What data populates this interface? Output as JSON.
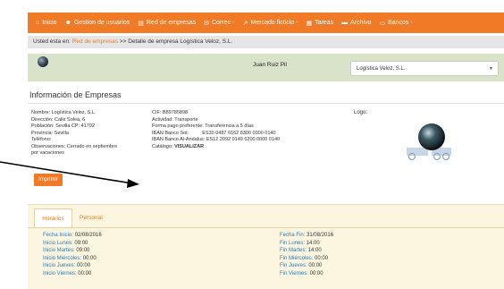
{
  "nav": {
    "items": [
      {
        "icon": "home-icon",
        "glyph": "⌂",
        "label": "Inicio"
      },
      {
        "icon": "users-icon",
        "glyph": "☻",
        "label": "Gestion de usuarios"
      },
      {
        "icon": "document-icon",
        "glyph": "▤",
        "label": "Red de empresas"
      },
      {
        "icon": "mail-icon",
        "glyph": "✉",
        "label": "Correo -"
      },
      {
        "icon": "chart-icon",
        "glyph": "↗",
        "label": "Mercado ficticio -"
      },
      {
        "icon": "calendar-icon",
        "glyph": "▦",
        "label": "Tareas"
      },
      {
        "icon": "folder-icon",
        "glyph": "▬",
        "label": "Archivo"
      },
      {
        "icon": "bank-icon",
        "glyph": "▭",
        "label": "Bancos -"
      }
    ],
    "color": "#f07a25"
  },
  "breadcrumb": {
    "prefix": "Usted esta en:",
    "link": "Red de empresas",
    "rest": ">> Detalle de empresa Logística Veloz, S.L."
  },
  "user": {
    "name": "Juan Ruiz Pil",
    "company_select": "Logística Veloz, S.L."
  },
  "company": {
    "title": "Información de Empresas",
    "left": [
      {
        "label": "Nombre:",
        "value": "Logística Veloz, S.L."
      },
      {
        "label": "Dirección:",
        "value": "Calle Soleá, 6"
      },
      {
        "label": "Población:",
        "value": "Sevilla CP: 41702"
      },
      {
        "label": "Provincia:",
        "value": "Sevilla"
      },
      {
        "label": "Teléfono:",
        "value": ""
      },
      {
        "label": "Observaciones:",
        "value": "Cerrado en septiembre"
      },
      {
        "label": "",
        "value": "por vacaciones"
      }
    ],
    "right": [
      {
        "label": "CIF:",
        "value": "B89785898"
      },
      {
        "label": "Actividad:",
        "value": "Transporte"
      },
      {
        "label": "Forma pago preferente:",
        "value": "Transferencia a 5 días"
      },
      {
        "label": "IBAN Banco Sol:",
        "value": "ES30 0487 0162 8300 0000 0140"
      },
      {
        "label": "IBAN Banco Al-Andalus:",
        "value": "ES12 2092 0149 6200 0000 0140"
      },
      {
        "label": "Catálogo:",
        "value": "VISUALIZAR"
      }
    ],
    "logo_label": "Logo:",
    "print_button": "Imprimir"
  },
  "tabs": {
    "active": "Horarios",
    "other": "Personal"
  },
  "schedule": {
    "left": [
      {
        "k": "Fecha Inicio:",
        "v": "02/08/2016"
      },
      {
        "k": "Inicio Lunes:",
        "v": "09:00"
      },
      {
        "k": "Inicio Martes:",
        "v": "09:00"
      },
      {
        "k": "Inicio Miércoles:",
        "v": "00:00"
      },
      {
        "k": "Inicio Jueves:",
        "v": "00:00"
      },
      {
        "k": "Inicio Viernes:",
        "v": "00:00"
      }
    ],
    "right": [
      {
        "k": "Fecha Fin:",
        "v": "31/08/2016"
      },
      {
        "k": "Fin Lunes:",
        "v": "14:00"
      },
      {
        "k": "Fin Martes:",
        "v": "14:00"
      },
      {
        "k": "Fin Miércoles:",
        "v": "00:00"
      },
      {
        "k": "Fin Jueves:",
        "v": "00:00"
      },
      {
        "k": "Fin Viernes:",
        "v": "00:00"
      }
    ]
  }
}
